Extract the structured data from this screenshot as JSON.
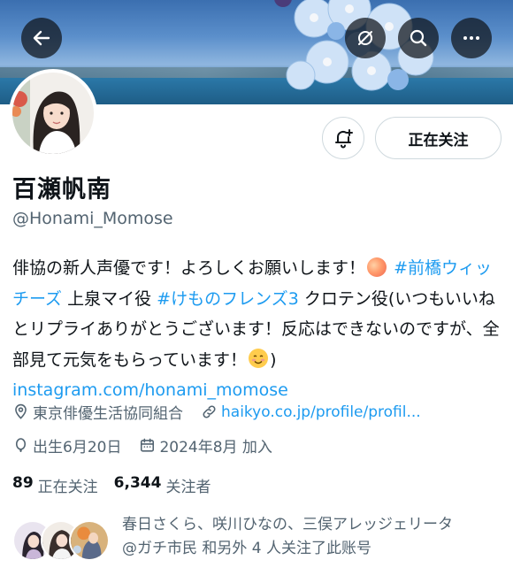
{
  "header": {
    "back_icon": "arrow-left-icon",
    "actions": [
      "grok-icon",
      "search-icon",
      "more-icon"
    ]
  },
  "profile": {
    "name": "百瀬帆南",
    "handle": "@Honami_Momose",
    "follow_button": "正在关注",
    "notify_icon": "bell-plus-icon"
  },
  "bio": {
    "line1_text": "俳協の新人声優です！よろしくお願いします！",
    "hashtag1": "#前橋ウィッチーズ",
    "line2_text": " 上泉マイ役 ",
    "hashtag2": "#けものフレンズ3",
    "line3_text": " クロテン役(いつもいいねとリプライありがとうございます！反応はできないのですが、全部見て元気をもらっています！",
    "link_close": ")",
    "instagram": "instagram.com/honami_momose"
  },
  "meta": {
    "location": "東京俳優生活協同組合",
    "website": "haikyo.co.jp/profile/profil...",
    "birthday": "出生6月20日",
    "joined": "2024年8月 加入"
  },
  "stats": {
    "following_count": "89",
    "following_label": "正在关注",
    "followers_count": "6,344",
    "followers_label": "关注者"
  },
  "known_followers": {
    "line1": "春日さくら、咲川ひなの、三俣アレッジェリータ",
    "line2": "@ガチ市民 和另外 4 人关注了此账号"
  },
  "colors": {
    "accent": "#1d9bf0",
    "secondary_text": "#536471",
    "border": "#cfd9de"
  }
}
